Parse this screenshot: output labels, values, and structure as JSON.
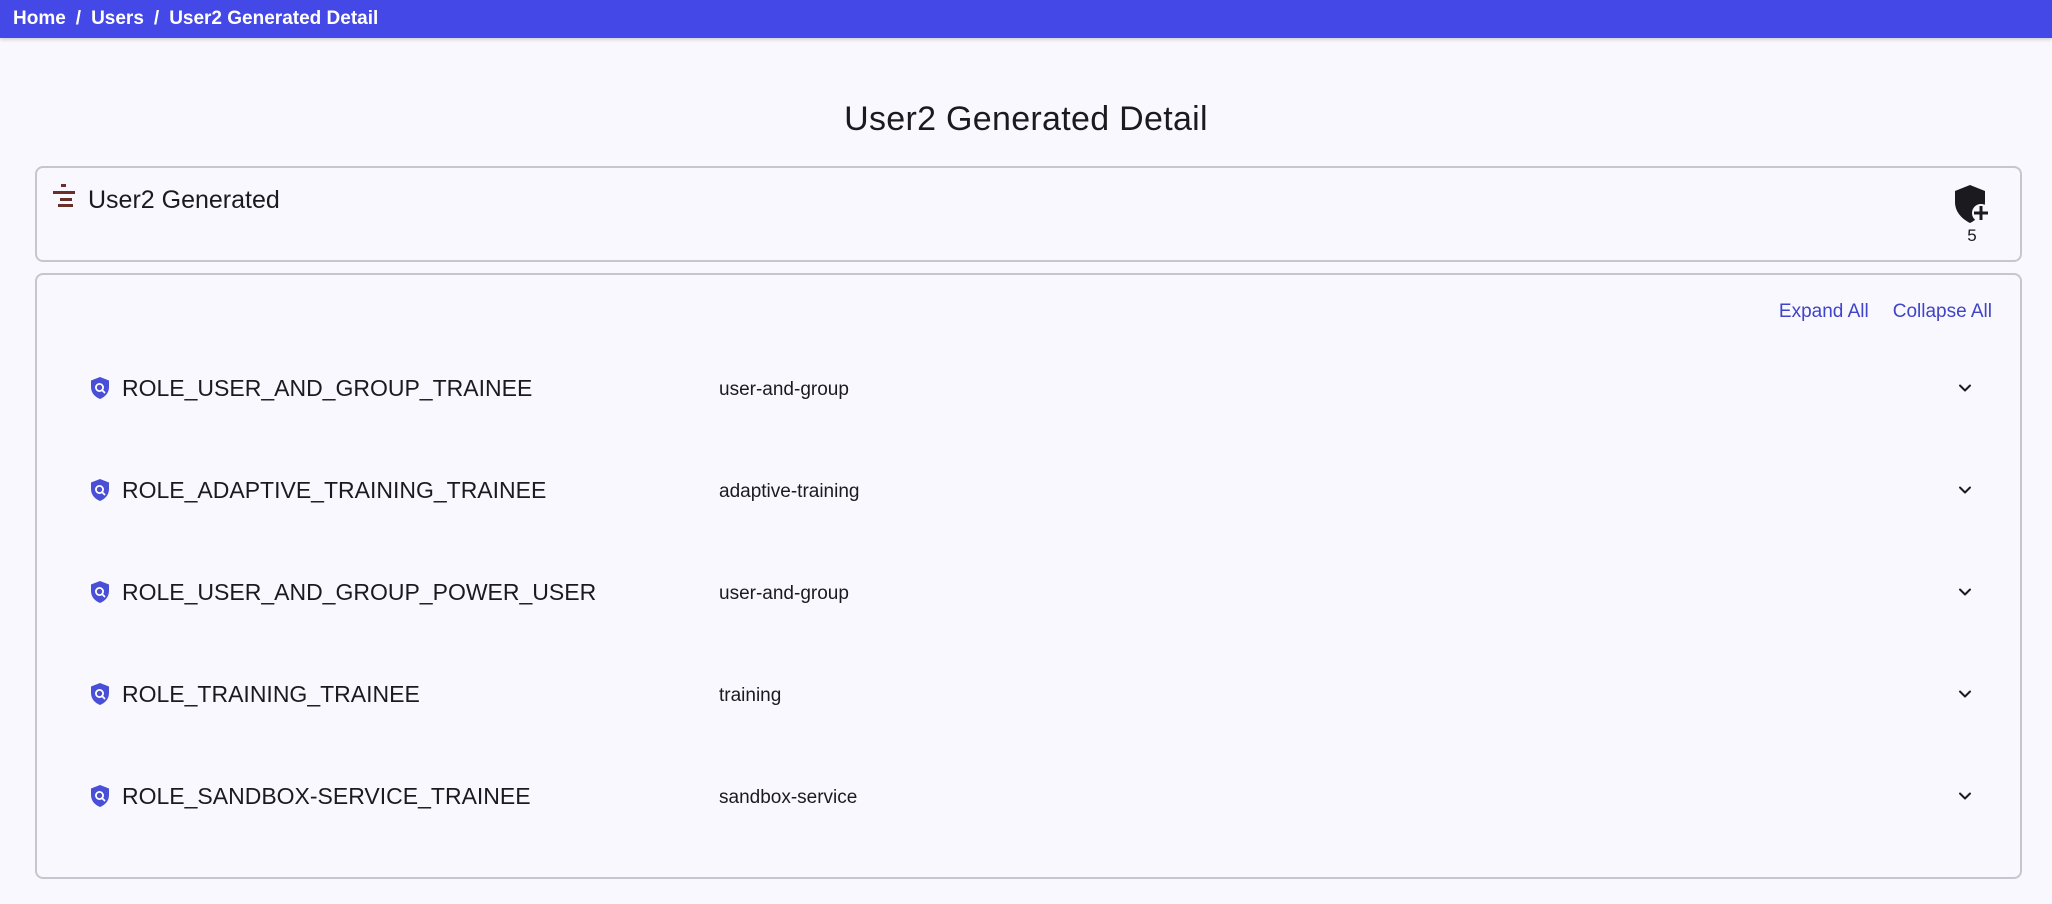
{
  "breadcrumb": {
    "items": [
      "Home",
      "Users",
      "User2 Generated Detail"
    ],
    "separator": "/"
  },
  "page": {
    "title": "User2 Generated Detail"
  },
  "user": {
    "name": "User2 Generated",
    "role_count": "5",
    "user_icon": "user-logo-icon",
    "add_role_icon": "shield-plus-icon"
  },
  "roles_panel": {
    "expand_all_label": "Expand All",
    "collapse_all_label": "Collapse All",
    "roles": [
      {
        "name": "ROLE_USER_AND_GROUP_TRAINEE",
        "service": "user-and-group"
      },
      {
        "name": "ROLE_ADAPTIVE_TRAINING_TRAINEE",
        "service": "adaptive-training"
      },
      {
        "name": "ROLE_USER_AND_GROUP_POWER_USER",
        "service": "user-and-group"
      },
      {
        "name": "ROLE_TRAINING_TRAINEE",
        "service": "training"
      },
      {
        "name": "ROLE_SANDBOX-SERVICE_TRAINEE",
        "service": "sandbox-service"
      }
    ]
  },
  "colors": {
    "topbar": "#4348e6",
    "accent": "#3f44c9",
    "role_icon": "#4a4fd8",
    "user_icon": "#6b2f2a",
    "border": "#c7c6d0",
    "background": "#f9f8fe"
  }
}
